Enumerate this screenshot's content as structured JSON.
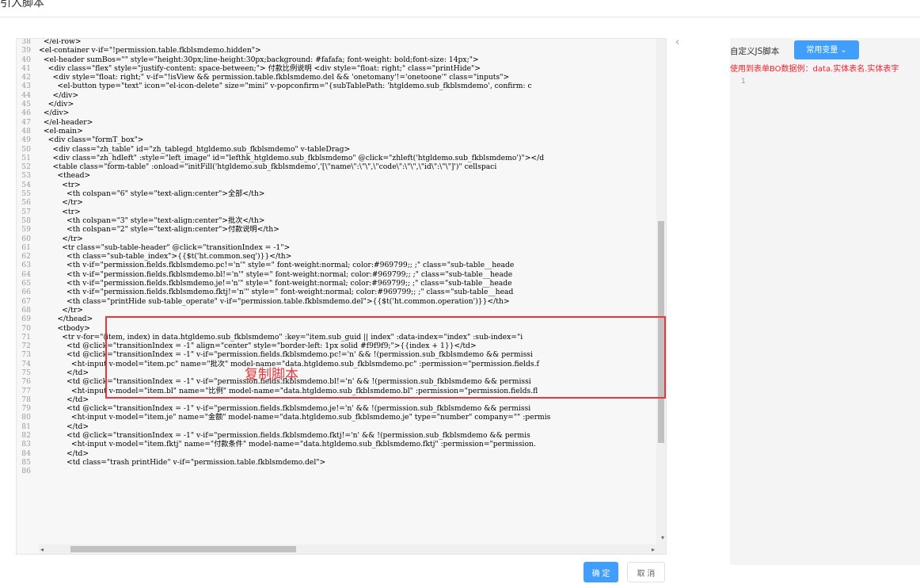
{
  "dialog": {
    "title": "引入脚本",
    "confirm_label": "确 定",
    "cancel_label": "取 消"
  },
  "annotation": "复制脚本",
  "right_panel": {
    "label": "自定义JS脚本",
    "button_label": "常用变量",
    "hint": "使用到表单BO数据例：data.实体表名.实体表字",
    "line_number": "1"
  },
  "editor": {
    "lines": [
      {
        "n": "38",
        "t": "  </el-row>"
      },
      {
        "n": "39",
        "t": "<el-container v-if=\"!permission.table.fkblsmdemo.hidden\">"
      },
      {
        "n": "40",
        "t": "  <el-header sumBos=\"\" style=\"height:30px;line-height:30px;background: #fafafa; font-weight: bold;font-size: 14px;\">"
      },
      {
        "n": "41",
        "t": "    <div class=\"flex\" style=\"justify-content: space-between;\"> 付款比例说明 <div style=\"float: right;\" class=\"printHide\">"
      },
      {
        "n": "42",
        "t": "      <div style=\"float: right;\" v-if=\"!isView && permission.table.fkblsmdemo.del && 'onetomany'!='onetoone'\" class=\"inputs\">"
      },
      {
        "n": "43",
        "t": "        <el-button type=\"text\" icon=\"el-icon-delete\" size=\"mini\" v-popconfirm=\"{subTablePath: 'htgldemo.sub_fkblsmdemo', confirm: c"
      },
      {
        "n": "44",
        "t": "      </div>"
      },
      {
        "n": "45",
        "t": "    </div>"
      },
      {
        "n": "46",
        "t": "  </div>"
      },
      {
        "n": "47",
        "t": "  </el-header>"
      },
      {
        "n": "48",
        "t": "  <el-main>"
      },
      {
        "n": "49",
        "t": "    <div class=\"formT_box\">"
      },
      {
        "n": "50",
        "t": "      <div class=\"zh_table\" id=\"zh_tablegd_htgldemo.sub_fkblsmdemo\" v-tableDrag>"
      },
      {
        "n": "51",
        "t": "      <div class=\"zh_hdleft\" :style=\"left_image\" id=\"lefthk_htgldemo.sub_fkblsmdemo\" @click=\"zhleft('htgldemo.sub_fkblsmdemo')\"></d"
      },
      {
        "n": "52",
        "t": "      <table class=\"form-table\" :onload=\"initFill('htgldemo.sub_fkblsmdemo','[\\\"name\\\":\\\"\\\",\\\"code\\\":\\\"\\\",\\\"id\\\":\\\"\\\"]')\" cellspaci"
      },
      {
        "n": "53",
        "t": "        <thead>"
      },
      {
        "n": "54",
        "t": "          <tr>"
      },
      {
        "n": "55",
        "t": "            <th colspan=\"6\" style=\"text-align:center\">全部</th>"
      },
      {
        "n": "56",
        "t": "          </tr>"
      },
      {
        "n": "57",
        "t": "          <tr>"
      },
      {
        "n": "58",
        "t": "            <th colspan=\"3\" style=\"text-align:center\">批次</th>"
      },
      {
        "n": "59",
        "t": "            <th colspan=\"2\" style=\"text-align:center\">付款说明</th>"
      },
      {
        "n": "60",
        "t": "          </tr>"
      },
      {
        "n": "61",
        "t": "          <tr class=\"sub-table-header\" @click=\"transitionIndex = -1\">"
      },
      {
        "n": "62",
        "t": "            <th class=\"sub-table_index\">{{$t('ht.common.seq')}}</th>"
      },
      {
        "n": "63",
        "t": "            <th v-if=\"permission.fields.fkblsmdemo.pc!='n'\" style=\" font-weight:normal; color:#969799;; ;\" class=\"sub-table__heade"
      },
      {
        "n": "64",
        "t": "            <th v-if=\"permission.fields.fkblsmdemo.bl!='n'\" style=\" font-weight:normal; color:#969799;; ;\" class=\"sub-table__heade"
      },
      {
        "n": "65",
        "t": "            <th v-if=\"permission.fields.fkblsmdemo.je!='n'\" style=\" font-weight:normal; color:#969799;; ;\" class=\"sub-table__heade"
      },
      {
        "n": "66",
        "t": "            <th v-if=\"permission.fields.fkblsmdemo.fktj!='n'\" style=\" font-weight:normal; color:#969799;; ;\" class=\"sub-table__head"
      },
      {
        "n": "67",
        "t": "            <th class=\"printHide sub-table_operate\" v-if=\"permission.table.fkblsmdemo.del\">{{$t('ht.common.operation')}}</th>"
      },
      {
        "n": "68",
        "t": "          </tr>"
      },
      {
        "n": "69",
        "t": "        </thead>"
      },
      {
        "n": "70",
        "t": "        <tbody>"
      },
      {
        "n": "71",
        "t": "          <tr v-for=\"(item, index) in data.htgldemo.sub_fkblsmdemo\" :key=\"item.sub_guid || index\" :data-index=\"index\" :sub-index=\"i"
      },
      {
        "n": "72",
        "t": "            <td @click=\"transitionIndex = -1\" align=\"center\" style=\"border-left: 1px solid #f9f9f9;\">{{index + 1}}</td>"
      },
      {
        "n": "73",
        "t": "            <td @click=\"transitionIndex = -1\" v-if=\"permission.fields.fkblsmdemo.pc!='n' && !(permission.sub_fkblsmdemo && permissi"
      },
      {
        "n": "74",
        "t": "              <ht-input v-model=\"item.pc\" name=\"批次\" model-name=\"data.htgldemo.sub_fkblsmdemo.pc\" :permission=\"permission.fields.f"
      },
      {
        "n": "75",
        "t": "            </td>"
      },
      {
        "n": "76",
        "t": "            <td @click=\"transitionIndex = -1\" v-if=\"permission.fields.fkblsmdemo.bl!='n' && !(permission.sub_fkblsmdemo && permissi"
      },
      {
        "n": "77",
        "t": "              <ht-input v-model=\"item.bl\" name=\"比例\" model-name=\"data.htgldemo.sub_fkblsmdemo.bl\" :permission=\"permission.fields.fl"
      },
      {
        "n": "78",
        "t": "            </td>"
      },
      {
        "n": "79",
        "t": "            <td @click=\"transitionIndex = -1\" v-if=\"permission.fields.fkblsmdemo.je!='n' && !(permission.sub_fkblsmdemo && permissi"
      },
      {
        "n": "80",
        "t": "              <ht-input v-model=\"item.je\" name=\"金额\" model-name=\"data.htgldemo.sub_fkblsmdemo.je\" type=\"number\" company=\"\" :permis"
      },
      {
        "n": "81",
        "t": "            </td>"
      },
      {
        "n": "82",
        "t": "            <td @click=\"transitionIndex = -1\" v-if=\"permission.fields.fkblsmdemo.fktj!='n' && !(permission.sub_fkblsmdemo && permis"
      },
      {
        "n": "83",
        "t": "              <ht-input v-model=\"item.fktj\" name=\"付款条件\" model-name=\"data.htgldemo.sub_fkblsmdemo.fktj\" :permission=\"permission."
      },
      {
        "n": "84",
        "t": "            </td>"
      },
      {
        "n": "85",
        "t": "            <td class=\"trash printHide\" v-if=\"permission.table.fkblsmdemo.del\">"
      },
      {
        "n": "86",
        "t": ""
      }
    ]
  }
}
